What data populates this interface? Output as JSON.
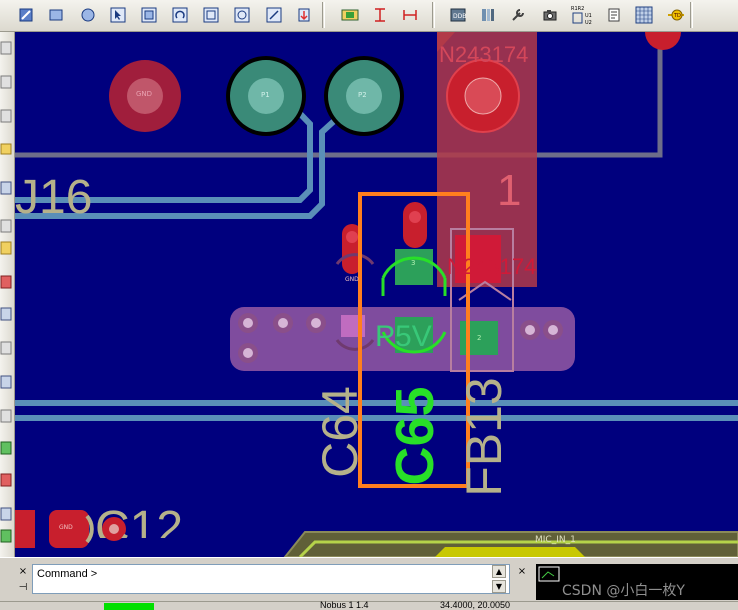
{
  "toolbar": {
    "buttons": [
      {
        "name": "place-trace-icon"
      },
      {
        "name": "rectangle-icon"
      },
      {
        "name": "circle-icon"
      },
      {
        "name": "select-arrow-icon"
      },
      {
        "name": "polygon-icon"
      },
      {
        "name": "rotate-icon"
      },
      {
        "name": "square-icon"
      },
      {
        "name": "round-square-icon"
      },
      {
        "name": "erase-icon"
      },
      {
        "name": "pin-icon"
      },
      {
        "name": "component-icon"
      },
      {
        "name": "measure-vertical-icon"
      },
      {
        "name": "measure-horizontal-icon"
      },
      {
        "name": "ddb-icon"
      },
      {
        "name": "layers-icon"
      },
      {
        "name": "tools-icon"
      },
      {
        "name": "camera-icon"
      },
      {
        "name": "netlist-icon"
      },
      {
        "name": "report-icon"
      },
      {
        "name": "grid-icon"
      },
      {
        "name": "teardrop-icon"
      }
    ],
    "netlist_label": "R1R2 U1 U2"
  },
  "board": {
    "net_labels": {
      "gnd_top": "GND",
      "p1": "P1",
      "p2": "P2",
      "net_top_right": "N243174",
      "pin_one": "1",
      "net_mid": "N243174",
      "gnd_small": "GND",
      "p5v": "P5V",
      "pad3": "3",
      "pad2": "2",
      "mic": "MIC_IN_1",
      "gnd_bottom": "GND"
    },
    "designators": {
      "j16": "J16",
      "c64": "C64",
      "c65": "C65",
      "fb13": "FB13",
      "c12": "C12"
    }
  },
  "command": {
    "label": "Command >"
  },
  "watermark": "CSDN @小白一枚Y",
  "status": {
    "coords": "34.4000, 20.0050",
    "mode": "Nobus 1 1.4"
  },
  "colors": {
    "canvas": "#00007e",
    "trace": "#5a8fb8",
    "silk": "#b5b18a",
    "highlight": "#ff7f1e",
    "green_silk": "#28e028"
  }
}
